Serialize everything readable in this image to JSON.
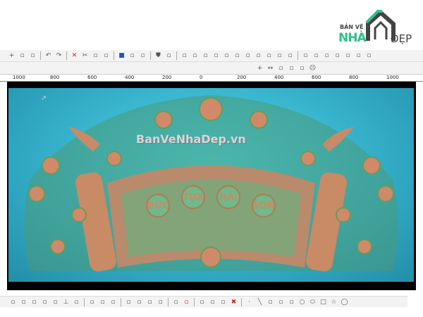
{
  "logo": {
    "line1": "BẢN VẼ",
    "line2": "NHÀ",
    "line3": "ĐẸP",
    "accent": "#2ec08a"
  },
  "toolbar_top": {
    "icons": [
      "snap-cross-icon",
      "select-box-icon",
      "dropdown-icon",
      "undo-icon",
      "redo-icon",
      "delete-icon",
      "cut-icon",
      "copy-icon",
      "paste-icon",
      "color-icon",
      "render-icon",
      "shade-icon",
      "shield-icon",
      "trim-icon",
      "angle-icon",
      "corner-icon",
      "corner2-icon",
      "box-icon",
      "edit-node-icon",
      "link-icon",
      "layer-icon",
      "group-icon",
      "ungroup-icon",
      "align-icon",
      "array-icon",
      "mirror-icon",
      "rotate-icon",
      "scale-icon",
      "table-icon",
      "arc-icon",
      "curve-icon",
      "spiral-icon"
    ]
  },
  "toolbar_view": {
    "icons": [
      "crosshair-icon",
      "measure-icon",
      "step-icon",
      "grid-icon",
      "angle-measure-icon",
      "skull-icon"
    ]
  },
  "ruler": {
    "labels": [
      "1000",
      "800",
      "600",
      "400",
      "200",
      "0",
      "200",
      "400",
      "600",
      "800",
      "1000"
    ]
  },
  "viewport": {
    "watermark": "BanVeNhaDep.vn",
    "inscription": [
      "ĐỨC",
      "TỰA",
      "HẢI",
      "SƠN"
    ],
    "background": "#3cc3dc"
  },
  "toolbar_bottom": {
    "icons": [
      "snap-icon",
      "snap-end-icon",
      "snap-mid-icon",
      "snap-center-icon",
      "snap-circle-icon",
      "perpendicular-icon",
      "tangent-icon",
      "node-icon",
      "vector-icon",
      "weld-icon",
      "subtract-icon",
      "intersect-icon",
      "offset-icon",
      "fillet-icon",
      "close-vector-icon",
      "delete-vector-icon",
      "transform-icon",
      "smooth-icon",
      "extend-icon",
      "delete-all-icon",
      "point-icon",
      "line-icon",
      "arc3-icon",
      "bezier-icon",
      "polyline-icon",
      "circle-icon",
      "ellipse-icon",
      "rectangle-icon",
      "star-icon",
      "polygon-icon"
    ]
  }
}
